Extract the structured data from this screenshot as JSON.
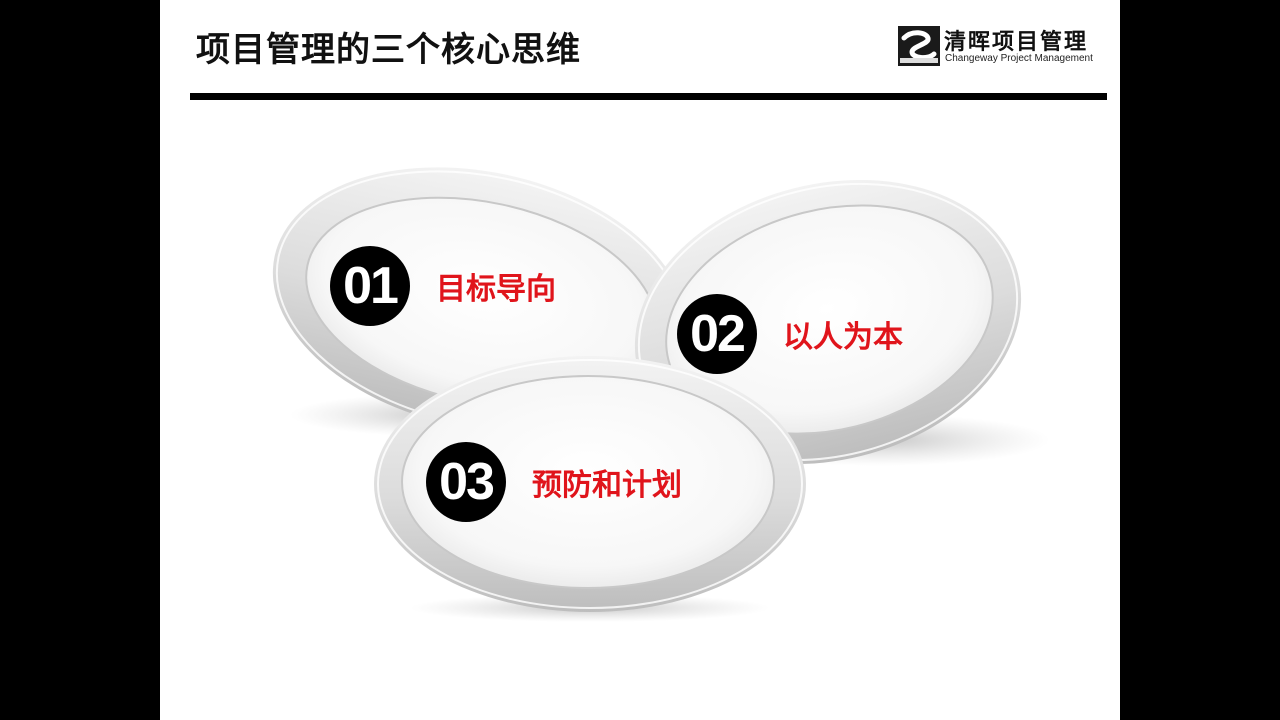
{
  "slide": {
    "title": "项目管理的三个核心思维",
    "logo": {
      "name_cn": "清晖项目管理",
      "name_en": "Changeway Project Management"
    }
  },
  "items": [
    {
      "number": "01",
      "label": "目标导向"
    },
    {
      "number": "02",
      "label": "以人为本"
    },
    {
      "number": "03",
      "label": "预防和计划"
    }
  ],
  "colors": {
    "label": "#e0141b",
    "badge": "#000000",
    "rule": "#000000"
  }
}
